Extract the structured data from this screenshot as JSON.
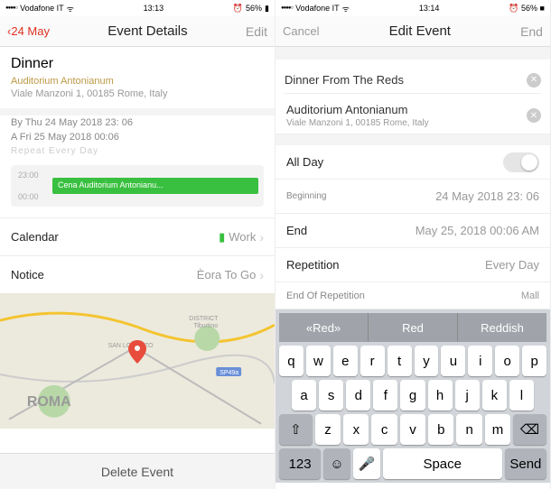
{
  "left": {
    "status": {
      "carrier": "Vodafone IT",
      "time": "13:13",
      "icons": "⏰ 56% ■",
      "alarm": "⏰",
      "battery_pct": "56%"
    },
    "nav": {
      "back": "24 May",
      "title": "Event Details",
      "right": "Edit"
    },
    "event": {
      "title": "Dinner",
      "location_name": "Auditorium Antonianum",
      "address": "Viale Manzoni 1, 00185 Rome, Italy",
      "start_line": "By Thu 24 May 2018 23: 06",
      "end_line": "A Fri 25 May 2018 00:06",
      "repeat": "Repeat Every Day"
    },
    "timeline": {
      "t1": "23:00",
      "t2": "00:00",
      "bar_label": "Cena Auditorium Antonianu..."
    },
    "rows": {
      "calendar_label": "Calendar",
      "calendar_value": "Work",
      "notice_label": "Notice",
      "notice_value": "Èora To Go"
    },
    "map_label": "ROMA",
    "delete": "Delete Event"
  },
  "right": {
    "status": {
      "carrier": "Vodafone IT",
      "time": "13:14",
      "icons": "⏰ 56% ■"
    },
    "nav": {
      "left": "Cancel",
      "title": "Edit Event",
      "right": "End"
    },
    "title_input": "Dinner From The Reds",
    "location": {
      "name": "Auditorium Antonianum",
      "address": "Viale Manzoni 1, 00185 Rome, Italy"
    },
    "rows": {
      "allday": "All Day",
      "begin_label": "Beginning",
      "begin_value": "24 May 2018 23: 06",
      "end_label": "End",
      "end_value": "May 25, 2018 00:06 AM",
      "rep_label": "Repetition",
      "rep_value": "Every Day",
      "eor_label": "End Of Repetition",
      "eor_value": "Mall"
    },
    "suggest": {
      "a": "«Red»",
      "b": "Red",
      "c": "Reddish"
    },
    "keys": {
      "r1": [
        "q",
        "w",
        "e",
        "r",
        "t",
        "y",
        "u",
        "i",
        "o",
        "p"
      ],
      "r2": [
        "a",
        "s",
        "d",
        "f",
        "g",
        "h",
        "j",
        "k",
        "l"
      ],
      "r3": [
        "z",
        "x",
        "c",
        "v",
        "b",
        "n",
        "m"
      ],
      "num": "123",
      "space": "Space",
      "send": "Send"
    }
  }
}
